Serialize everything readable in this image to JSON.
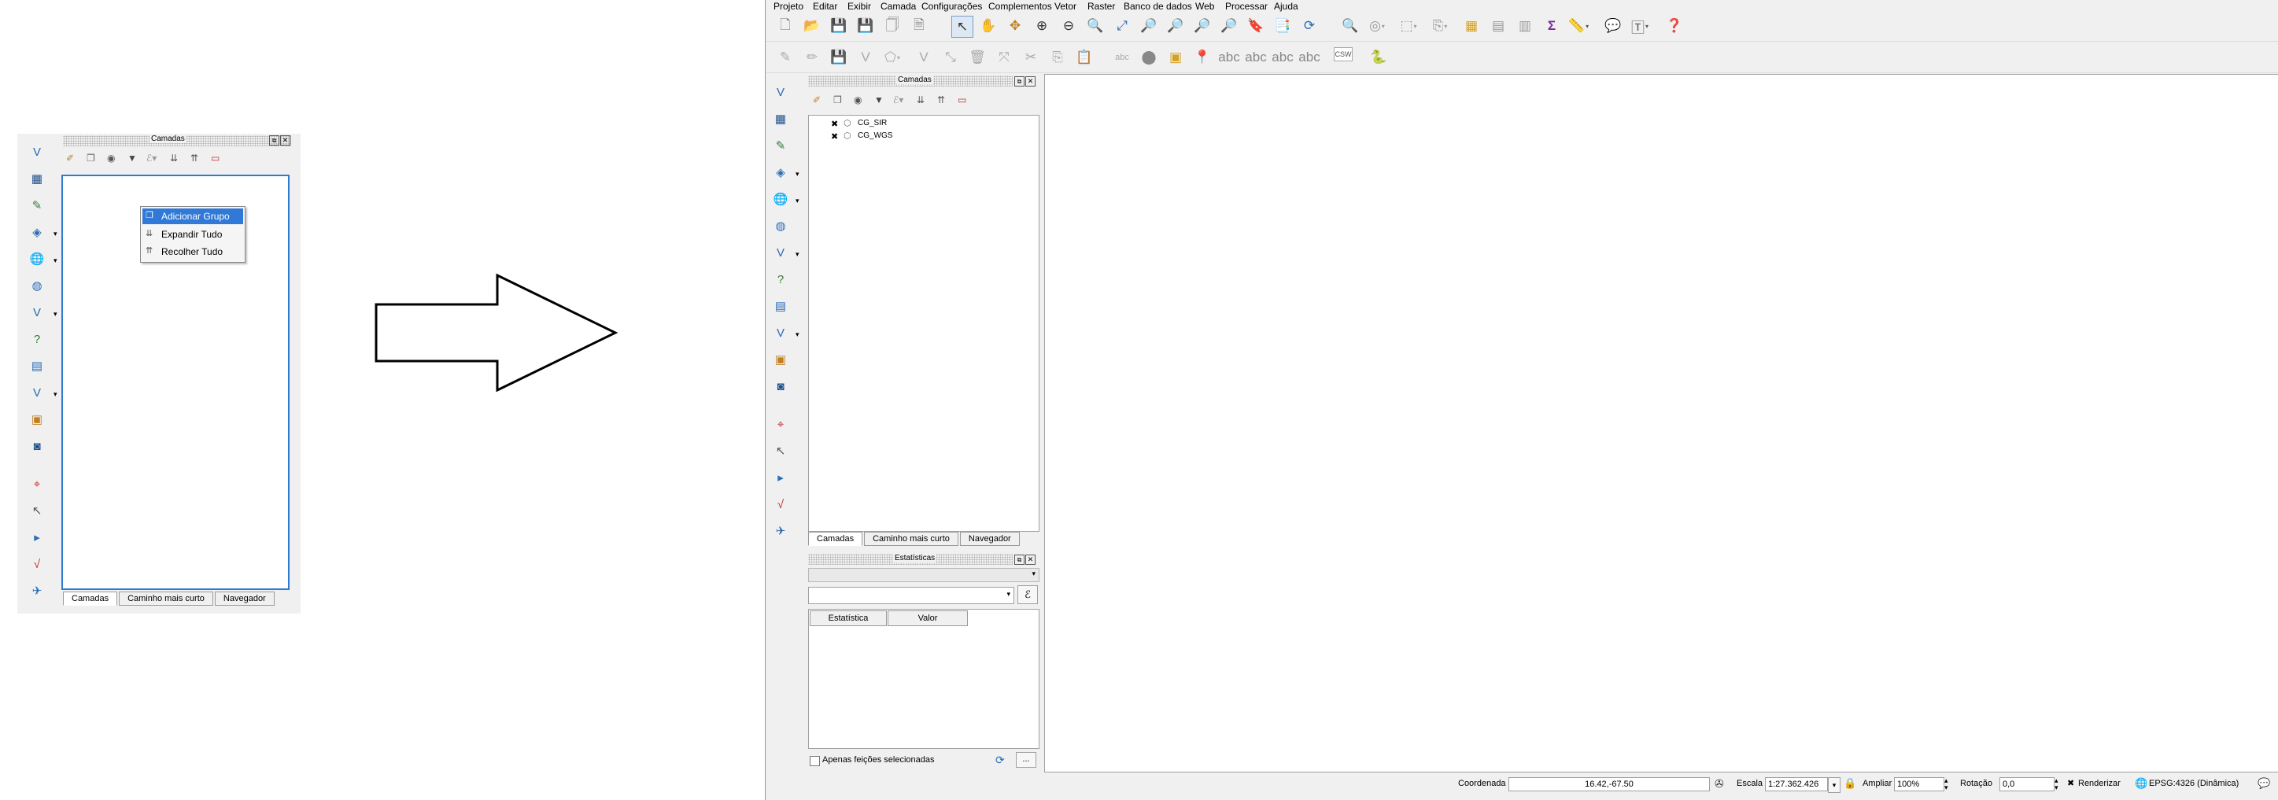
{
  "left": {
    "panel_title": "Camadas",
    "context_menu": [
      {
        "label": "Adicionar Grupo",
        "icon": "add-group-icon"
      },
      {
        "label": "Expandir Tudo",
        "icon": "expand-all-icon"
      },
      {
        "label": "Recolher Tudo",
        "icon": "collapse-all-icon"
      }
    ],
    "tabs": [
      "Camadas",
      "Caminho mais curto",
      "Navegador"
    ]
  },
  "right": {
    "menu": [
      "Projeto",
      "Editar",
      "Exibir",
      "Camada",
      "Configurações",
      "Complementos",
      "Vetor",
      "Raster",
      "Banco de dados",
      "Web",
      "Processar",
      "Ajuda"
    ],
    "layers_title": "Camadas",
    "layers": [
      "CG_SIR",
      "CG_WGS"
    ],
    "tabs": [
      "Camadas",
      "Caminho mais curto",
      "Navegador"
    ],
    "stats_title": "Estatísticas",
    "stats_columns": [
      "Estatística",
      "Valor"
    ],
    "only_selected": "Apenas feições selecionadas",
    "more_button": "...",
    "csw_label": "CSW",
    "status": {
      "coordinate_label": "Coordenada",
      "coordinate_value": "16.42,-67.50",
      "scale_label": "Escala",
      "scale_value": "1:27.362.426",
      "zoom_label": "Ampliar",
      "zoom_value": "100%",
      "rotation_label": "Rotação",
      "rotation_value": "0,0",
      "render_label": "Renderizar",
      "crs_label": "EPSG:4326 (Dinâmica)"
    }
  },
  "colors": {
    "highlight": "#3079d6",
    "panel_border": "#2f7bd1",
    "chrome": "#f0f0f0"
  }
}
